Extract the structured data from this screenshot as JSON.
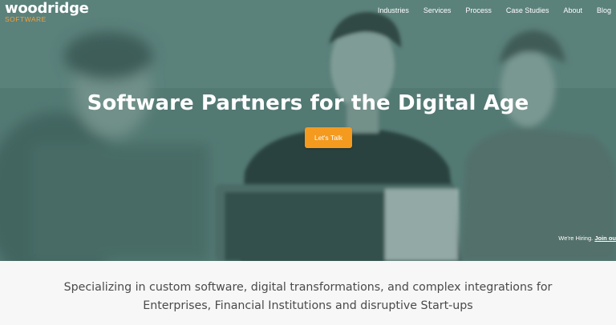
{
  "logo": {
    "word": "woodridge",
    "sub": "SOFTWARE"
  },
  "nav": {
    "items": [
      {
        "label": "Industries"
      },
      {
        "label": "Services"
      },
      {
        "label": "Process"
      },
      {
        "label": "Case Studies"
      },
      {
        "label": "About"
      },
      {
        "label": "Blog"
      }
    ]
  },
  "hero": {
    "headline": "Software Partners for the Digital Age",
    "cta_label": "Let's Talk",
    "hiring_text": "We're Hiring.",
    "hiring_link": "Join ou"
  },
  "tagline": {
    "line1": "Specializing in custom software, digital transformations, and complex integrations for",
    "line2": "Enterprises, Financial Institutions and disruptive Start-ups"
  },
  "colors": {
    "hero_overlay": "#4f7570",
    "cta": "#f39a1f",
    "logo_accent": "#f2a13a",
    "tagline_text": "#4a4a4a",
    "section_bg": "#f7f7f7"
  }
}
